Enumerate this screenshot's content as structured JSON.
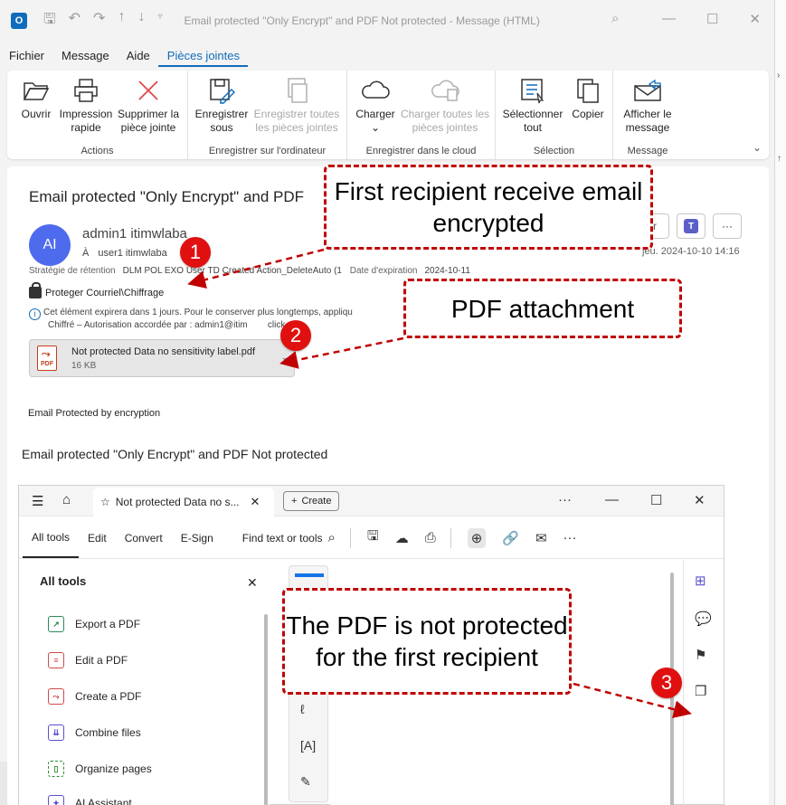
{
  "window": {
    "app_icon": "O",
    "title": "Email protected \"Only Encrypt\" and PDF Not protected  -  Message (HTML)"
  },
  "menu": {
    "tabs": [
      {
        "label": "Fichier"
      },
      {
        "label": "Message"
      },
      {
        "label": "Aide"
      },
      {
        "label": "Pièces jointes",
        "active": true
      }
    ]
  },
  "ribbon": {
    "groups": {
      "actions": "Actions",
      "save_computer": "Enregistrer sur l'ordinateur",
      "save_cloud": "Enregistrer dans le cloud",
      "selection": "Sélection",
      "message": "Message"
    },
    "buttons": {
      "open": "Ouvrir",
      "quick_print": "Impression rapide",
      "remove": "Supprimer la pièce jointe",
      "save_as": "Enregistrer sous",
      "save_all": "Enregistrer toutes les pièces jointes",
      "upload": "Charger",
      "upload_all": "Charger toutes les pièces jointes",
      "select_all": "Sélectionner tout",
      "copy": "Copier",
      "show_message": "Afficher le message"
    }
  },
  "message": {
    "subject": "Email protected \"Only Encrypt\" and PDF",
    "avatar": "AI",
    "sender": "admin1 itimwlaba",
    "to_label": "À",
    "to": "user1 itimwlaba",
    "date": "jeu. 2024-10-10 14:16",
    "retention_label": "Stratégie de rétention",
    "retention_value": "DLM POL EXO User TD Created Action_DeleteAuto (1",
    "expiry_label": "Date d'expiration",
    "expiry_value": "2024-10-11",
    "protection": "Proteger Courriel\\Chiffrage",
    "info_line1": "Cet élément expirera dans 1 jours. Pour le conserver plus longtemps, appliqu",
    "info_line2": "Chiffré – Autorisation accordée par : admin1@itim",
    "info_line2_end": "click",
    "attachment_name": "Not protected Data no sensitivity label.pdf",
    "attachment_size": "16 KB",
    "attachment_type": "PDF",
    "body_line1": "Email Protected by encryption",
    "body_line2": "Email protected \"Only Encrypt\" and PDF Not protected"
  },
  "pdf_viewer": {
    "tab_title": "Not protected Data no s...",
    "create": "Create",
    "tools": {
      "all": "All tools",
      "edit": "Edit",
      "convert": "Convert",
      "esign": "E-Sign"
    },
    "find": "Find text or tools",
    "panel_title": "All tools",
    "items": [
      {
        "label": "Export a PDF",
        "color": "#2d8a5a"
      },
      {
        "label": "Edit a PDF",
        "color": "#d14a4a"
      },
      {
        "label": "Create a PDF",
        "color": "#d14a4a"
      },
      {
        "label": "Combine files",
        "color": "#5a4fcf"
      },
      {
        "label": "Organize pages",
        "color": "#2d8a2d"
      },
      {
        "label": "AI Assistant",
        "color": "#5a4fcf"
      }
    ]
  },
  "annotations": {
    "callout1": "First recipient receive email encrypted",
    "callout2": "PDF attachment",
    "callout3": "The PDF is not protected for the first recipient",
    "badge1": "1",
    "badge2": "2",
    "badge3": "3",
    "color": "#c00000"
  }
}
